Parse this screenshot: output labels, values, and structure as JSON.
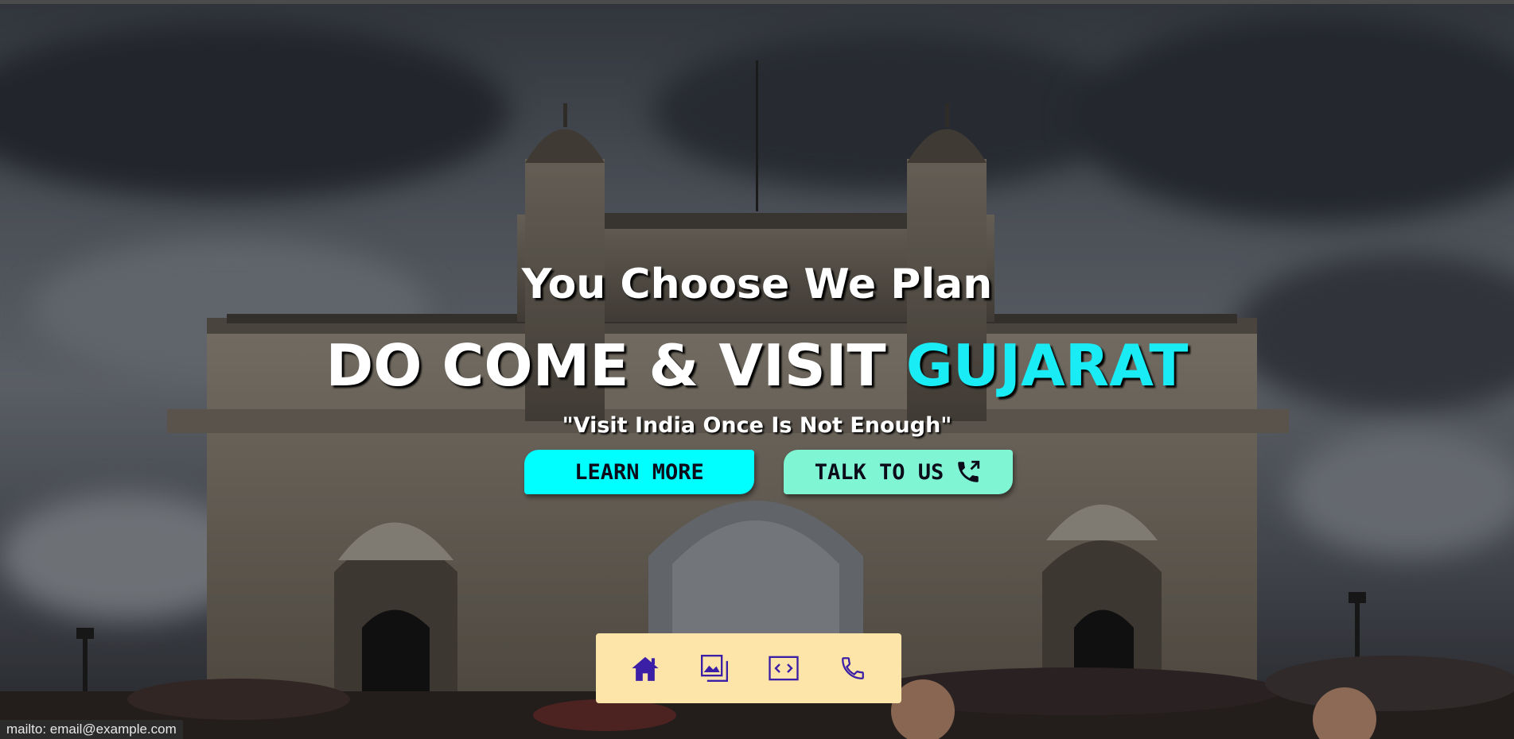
{
  "hero": {
    "tagline": "You Choose We Plan",
    "headline_main": "DO COME & VISIT ",
    "headline_accent": "GUJARAT",
    "quote": "\"Visit India Once Is Not Enough\""
  },
  "buttons": {
    "learn_more": "LEARN MORE",
    "talk_to_us": "TALK TO US"
  },
  "dock": {
    "items": [
      {
        "icon": "home-icon"
      },
      {
        "icon": "gallery-icon"
      },
      {
        "icon": "code-icon"
      },
      {
        "icon": "phone-icon"
      }
    ]
  },
  "status_bar": {
    "url": "mailto: email@example.com"
  },
  "colors": {
    "accent": "#19ecf5",
    "learn_button": "#00ffff",
    "talk_button": "#7ff5d3",
    "dock_bg": "#fde4a8",
    "dock_icon": "#3b1fa6"
  }
}
